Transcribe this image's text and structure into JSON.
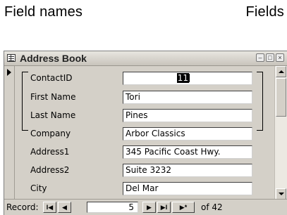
{
  "callouts": {
    "left": "Field names",
    "right": "Fields"
  },
  "window": {
    "title": "Address Book",
    "minimize_glyph": "–",
    "restore_glyph": "□",
    "close_glyph": "×"
  },
  "form": {
    "fields": [
      {
        "label": "ContactID",
        "value": "11"
      },
      {
        "label": "First Name",
        "value": "Tori"
      },
      {
        "label": "Last Name",
        "value": "Pines"
      },
      {
        "label": "Company",
        "value": "Arbor Classics"
      },
      {
        "label": "Address1",
        "value": "345 Pacific Coast Hwy."
      },
      {
        "label": "Address2",
        "value": "Suite 3232"
      },
      {
        "label": "City",
        "value": "Del Mar"
      }
    ]
  },
  "navigation": {
    "label": "Record:",
    "current_record": "5",
    "of_text": "of 42",
    "first_glyph": "I◀",
    "prev_glyph": "◀",
    "next_glyph": "▶",
    "last_glyph": "▶I",
    "new_glyph": "▶*"
  }
}
